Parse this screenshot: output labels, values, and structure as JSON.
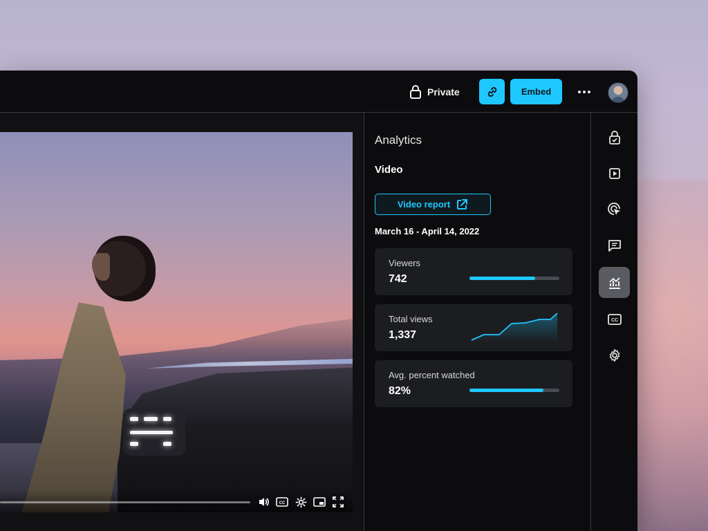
{
  "header": {
    "privacy_label": "Private",
    "embed_label": "Embed",
    "accent_color": "#1ec8ff"
  },
  "analytics": {
    "title": "Analytics",
    "subtitle": "Video",
    "report_button": "Video report",
    "date_range": "March 16 - April 14, 2022",
    "metrics": [
      {
        "label": "Viewers",
        "value": "742",
        "bar_fraction": 0.73
      },
      {
        "label": "Total views",
        "value": "1,337",
        "chart": "sparkline"
      },
      {
        "label": "Avg. percent watched",
        "value": "82%",
        "bar_fraction": 0.82
      }
    ]
  },
  "icons": {
    "header": [
      "lock-icon",
      "link-icon",
      "more-icon",
      "avatar"
    ],
    "video_controls": [
      "volume-icon",
      "captions-icon",
      "settings-icon",
      "pip-icon",
      "fullscreen-icon"
    ],
    "rail": [
      "lock-check-icon",
      "play-icon",
      "click-target-icon",
      "comment-icon",
      "analytics-icon",
      "captions-icon",
      "settings-icon"
    ]
  },
  "rail": {
    "active": "analytics-icon"
  }
}
